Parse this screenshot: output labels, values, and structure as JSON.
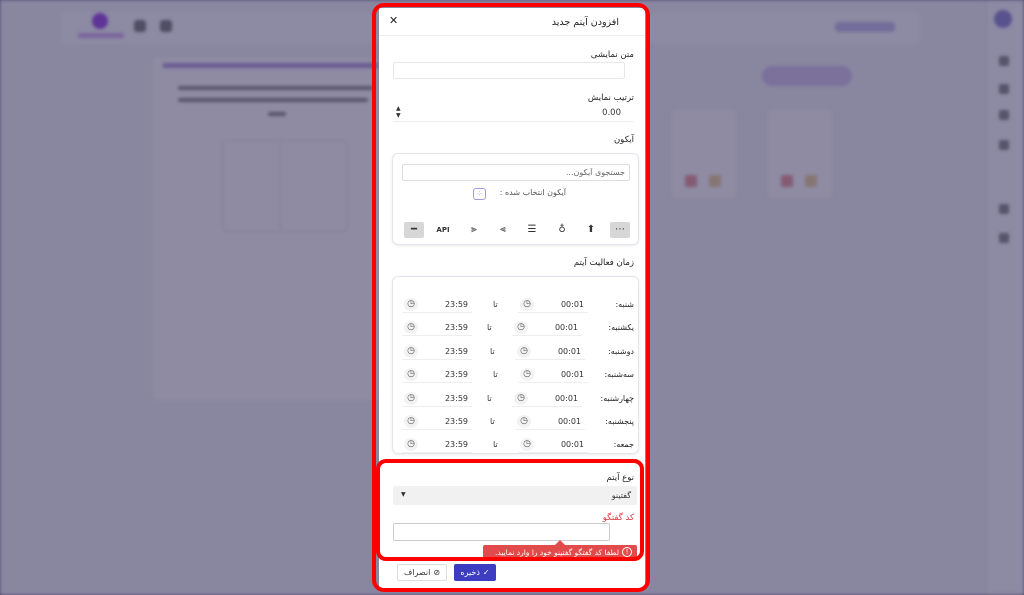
{
  "modal": {
    "title": "افزودن آیتم جدید",
    "close_glyph": "✕"
  },
  "display_text": {
    "label": "متن نمایشی",
    "value": ""
  },
  "display_order": {
    "label": "ترتیب نمایش",
    "value": "0.00"
  },
  "icon": {
    "label": "آیکون",
    "search_placeholder": "جستجوی آیکون...",
    "selected_label": "آیکون انتخاب شده :",
    "icons": [
      {
        "name": "more-icon",
        "glyph": "⋯",
        "selected": true
      },
      {
        "name": "cloud-upload-icon",
        "glyph": "⬆",
        "selected": false
      },
      {
        "name": "bulb-icon",
        "glyph": "♁",
        "selected": false
      },
      {
        "name": "align-center-icon",
        "glyph": "☰",
        "selected": false
      },
      {
        "name": "align-left-icon",
        "glyph": "⫷",
        "selected": false
      },
      {
        "name": "align-right-icon",
        "glyph": "⫸",
        "selected": false
      },
      {
        "name": "api-icon",
        "glyph": "API",
        "selected": false
      },
      {
        "name": "minus-icon",
        "glyph": "━",
        "selected": true
      }
    ]
  },
  "schedule": {
    "label": "زمان فعالیت آیتم",
    "to_label": "تا",
    "days": [
      {
        "day": "شنبه:",
        "from": "00:01",
        "to": "23:59"
      },
      {
        "day": "یکشنبه:",
        "from": "00:01",
        "to": "23:59"
      },
      {
        "day": "دوشنبه:",
        "from": "00:01",
        "to": "23:59"
      },
      {
        "day": "سه‌شنبه:",
        "from": "00:01",
        "to": "23:59"
      },
      {
        "day": "چهارشنبه:",
        "from": "00:01",
        "to": "23:59"
      },
      {
        "day": "پنجشنبه:",
        "from": "00:01",
        "to": "23:59"
      },
      {
        "day": "جمعه:",
        "from": "00:01",
        "to": "23:59"
      }
    ]
  },
  "item_type": {
    "label": "نوع آیتم",
    "selected": "گفتینو"
  },
  "chat_code": {
    "label": "کد گفتگو",
    "value": "",
    "error": "لطفا کد گفتگو گفتینو خود را وارد نمایید."
  },
  "actions": {
    "save": "ذخیره",
    "cancel": "انصراف"
  },
  "colors": {
    "primary": "#3d3dc2",
    "error": "#e24b4b",
    "highlight": "#ff0000"
  }
}
